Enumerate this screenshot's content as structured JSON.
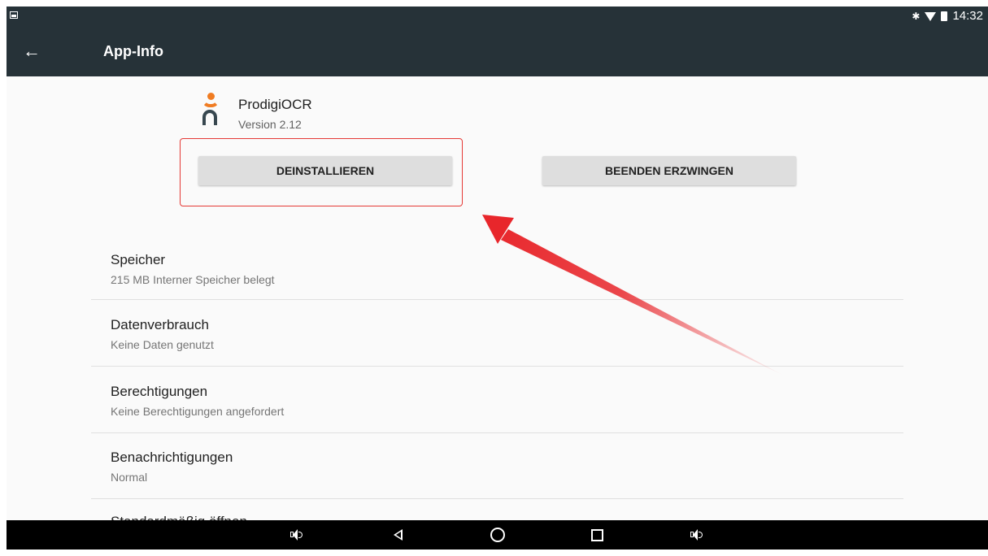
{
  "status_bar": {
    "time": "14:32"
  },
  "app_bar": {
    "title": "App-Info",
    "back_icon": "arrow-back-icon"
  },
  "app": {
    "name": "ProdigiOCR",
    "version": "Version 2.12",
    "icon": "prodigiocr-logo-icon"
  },
  "buttons": {
    "uninstall": "DEINSTALLIEREN",
    "force_stop": "BEENDEN ERZWINGEN"
  },
  "list": [
    {
      "title": "Speicher",
      "subtitle": "215 MB Interner Speicher belegt"
    },
    {
      "title": "Datenverbrauch",
      "subtitle": "Keine Daten genutzt"
    },
    {
      "title": "Berechtigungen",
      "subtitle": "Keine Berechtigungen angefordert"
    },
    {
      "title": "Benachrichtigungen",
      "subtitle": "Normal"
    },
    {
      "title": "Standardmäßig öffnen"
    }
  ],
  "nav_bar": {
    "icons": [
      "volume-down-icon",
      "back-icon",
      "home-icon",
      "recents-icon",
      "volume-up-icon"
    ]
  },
  "colors": {
    "appbar": "#263238",
    "accent_orange": "#f07c22",
    "highlight_red": "#e53935",
    "arrow_red": "#e8262b"
  }
}
